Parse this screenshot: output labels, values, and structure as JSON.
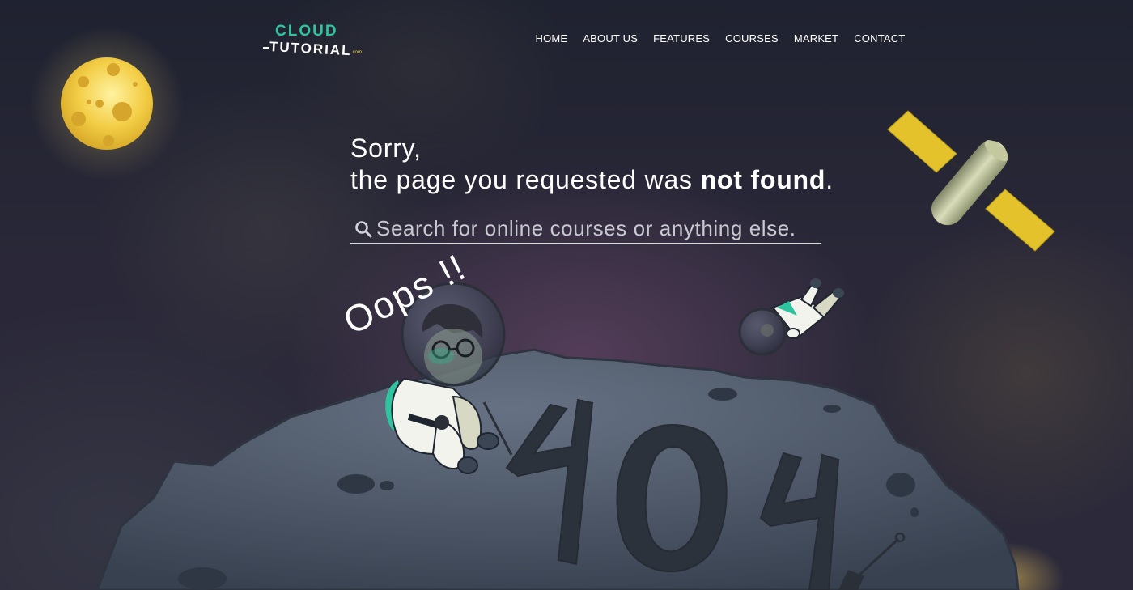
{
  "logo": {
    "line1": "CLOUD",
    "line2": "TUTORIAL",
    "suffix": ".com"
  },
  "nav": {
    "items": [
      {
        "label": "HOME"
      },
      {
        "label": "ABOUT US"
      },
      {
        "label": "FEATURES"
      },
      {
        "label": "COURSES"
      },
      {
        "label": "MARKET"
      },
      {
        "label": "CONTACT"
      }
    ]
  },
  "message": {
    "line1": "Sorry,",
    "line2_prefix": "the page you requested was ",
    "line2_emphasis": "not found",
    "line2_suffix": "."
  },
  "search": {
    "placeholder": "Search for online courses or anything else.",
    "value": ""
  },
  "illustration": {
    "exclamation": "Oops !!",
    "planet_number": "404",
    "icons": [
      "moon-icon",
      "satellite-icon",
      "astronaut-sitting-icon",
      "astronaut-floating-icon",
      "planet-icon",
      "shovel-icon",
      "search-icon"
    ]
  },
  "colors": {
    "background": "#262634",
    "accent": "#2ec4a0",
    "moon": "#f0c93e",
    "satellite_panel": "#e1c028",
    "planet": "#4c5666",
    "text": "#ffffff"
  }
}
